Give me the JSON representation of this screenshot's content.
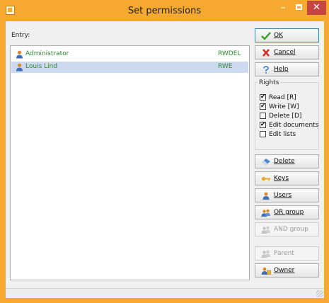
{
  "window": {
    "title": "Set permissions",
    "minimize_glyph": "–",
    "close_glyph": "✕"
  },
  "entry_label": "Entry:",
  "entries": [
    {
      "name": "Administrator",
      "rights": "RWDEL",
      "icon": "user-icon",
      "selected": false
    },
    {
      "name": "Louis Lind",
      "rights": "RWE",
      "icon": "user-icon",
      "selected": true
    }
  ],
  "buttons": {
    "ok": "OK",
    "cancel": "Cancel",
    "help": "Help",
    "delete": "Delete",
    "keys": "Keys",
    "users": "Users",
    "or_group": "OR group",
    "and_group": "AND group",
    "parent": "Parent",
    "owner": "Owner"
  },
  "rights": {
    "title": "Rights",
    "items": [
      {
        "label": "Read [R]",
        "checked": true
      },
      {
        "label": "Write [W]",
        "checked": true
      },
      {
        "label": "Delete [D]",
        "checked": false
      },
      {
        "label": "Edit documents",
        "checked": true
      },
      {
        "label": "Edit lists",
        "checked": false
      }
    ]
  },
  "colors": {
    "accent": "#f6a92f",
    "entry_text": "#2d8a30",
    "selection": "#cdd8f1",
    "close": "#c64542"
  }
}
